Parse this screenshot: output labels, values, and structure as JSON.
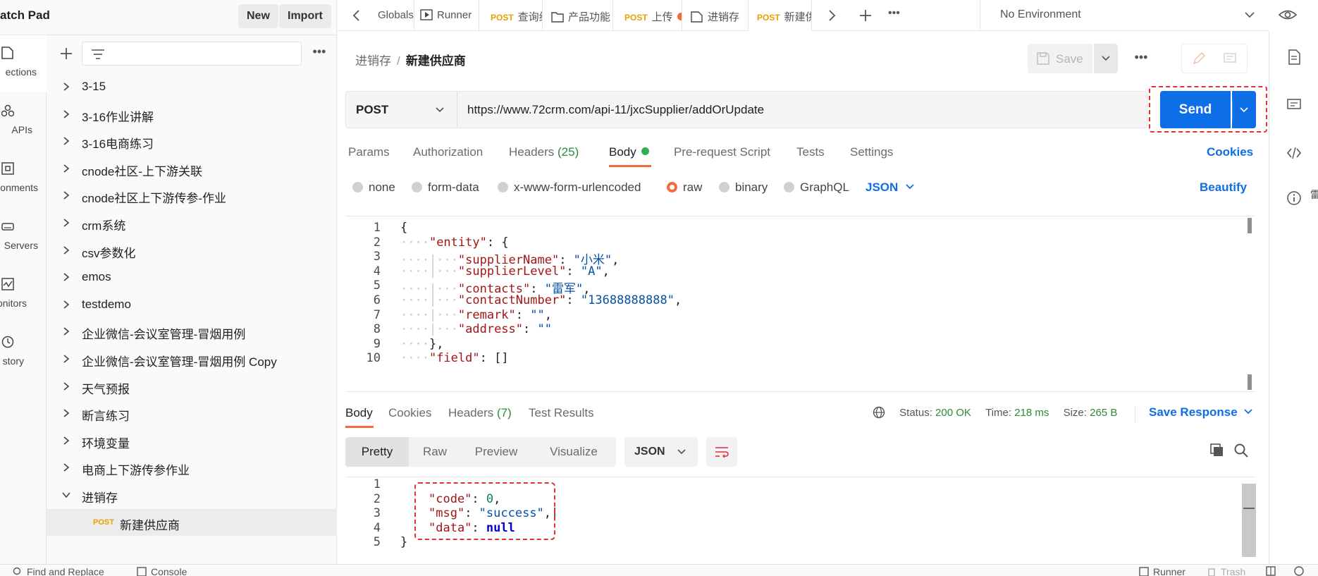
{
  "workspace": {
    "title": "atch Pad",
    "new_label": "New",
    "import_label": "Import"
  },
  "rail": [
    {
      "label": "ections",
      "icon": "collections-icon"
    },
    {
      "label": "APIs",
      "icon": "apis-icon"
    },
    {
      "label": "onments",
      "icon": "environments-icon"
    },
    {
      "label": "Servers",
      "icon": "mock-servers-icon"
    },
    {
      "label": "onitors",
      "icon": "monitors-icon"
    },
    {
      "label": "story",
      "icon": "history-icon"
    }
  ],
  "sidebar": {
    "collections": [
      "3-15",
      "3-16作业讲解",
      "3-16电商练习",
      "cnode社区-上下游关联",
      "cnode社区上下游传参-作业",
      "crm系统",
      "csv参数化",
      "emos",
      "testdemo",
      "企业微信-会议室管理-冒烟用例",
      "企业微信-会议室管理-冒烟用例 Copy",
      "天气预报",
      "断言练习",
      "环境变量",
      "电商上下游传参作业",
      "进销存"
    ],
    "child": {
      "method": "POST",
      "name": "新建供应商"
    }
  },
  "tabs": [
    {
      "method": "",
      "title": "Globals",
      "icon": "globe-icon"
    },
    {
      "method": "",
      "title": "Runner",
      "icon": "runner-icon"
    },
    {
      "method": "POST",
      "title": "查询组",
      "icon": ""
    },
    {
      "method": "",
      "title": "产品功能",
      "icon": "folder-icon"
    },
    {
      "method": "POST",
      "title": "上传",
      "icon": ""
    },
    {
      "method": "",
      "title": "进销存",
      "icon": "collection-icon"
    },
    {
      "method": "POST",
      "title": "新建供",
      "icon": ""
    }
  ],
  "environment": {
    "label": "No Environment"
  },
  "request": {
    "breadcrumb_parent": "进销存",
    "breadcrumb_separator": "/",
    "breadcrumb_current": "新建供应商",
    "save_label": "Save",
    "method": "POST",
    "url": "https://www.72crm.com/api-11/jxcSupplier/addOrUpdate",
    "send_label": "Send",
    "tabs": {
      "params": "Params",
      "authorization": "Authorization",
      "headers": "Headers",
      "headers_count": "(25)",
      "body": "Body",
      "prerequest": "Pre-request Script",
      "tests": "Tests",
      "settings": "Settings"
    },
    "cookies_label": "Cookies",
    "body_types": {
      "none": "none",
      "form_data": "form-data",
      "urlencoded": "x-www-form-urlencoded",
      "raw": "raw",
      "binary": "binary",
      "graphql": "GraphQL"
    },
    "selected_body_type": "raw",
    "raw_language": "JSON",
    "beautify_label": "Beautify",
    "line_numbers": [
      "1",
      "2",
      "3",
      "4",
      "5",
      "6",
      "7",
      "8",
      "9",
      "10"
    ],
    "code": {
      "l1": "{",
      "entity_key": "\"entity\"",
      "l2_tail": ": {",
      "supplierName_key": "\"supplierName\"",
      "supplierName_val": "\"小米\"",
      "supplierLevel_key": "\"supplierLevel\"",
      "supplierLevel_val": "\"A\"",
      "contacts_key": "\"contacts\"",
      "contacts_val": "\"雷军\"",
      "contactNumber_key": "\"contactNumber\"",
      "contactNumber_val": "\"13688888888\"",
      "remark_key": "\"remark\"",
      "remark_val": "\"\"",
      "address_key": "\"address\"",
      "address_val": "\"\"",
      "l9": "},",
      "field_key": "\"field\"",
      "field_val": "[]"
    }
  },
  "response": {
    "tabs": {
      "body": "Body",
      "cookies": "Cookies",
      "headers": "Headers",
      "headers_count": "(7)",
      "test_results": "Test Results"
    },
    "status_label": "Status:",
    "status": "200 OK",
    "time_label": "Time:",
    "time": "218 ms",
    "size_label": "Size:",
    "size": "265 B",
    "save_label": "Save Response",
    "view_modes": {
      "pretty": "Pretty",
      "raw": "Raw",
      "preview": "Preview",
      "visualize": "Visualize"
    },
    "language": "JSON",
    "line_numbers": [
      "1",
      "2",
      "3",
      "4",
      "5"
    ],
    "code": {
      "code_key": "\"code\"",
      "code_val": "0",
      "msg_key": "\"msg\"",
      "msg_val": "\"success\"",
      "data_key": "\"data\"",
      "data_val": "null",
      "close": "}"
    }
  },
  "right_rail_edge_text": "雷",
  "footer": {
    "find_replace": "Find and Replace",
    "console": "Console",
    "runner": "Runner",
    "trash": "Trash"
  },
  "colors": {
    "accent": "#0d6ee8",
    "method_post": "#e8a100",
    "active_tab": "#f26b3a",
    "status_ok": "#2c8a3a",
    "highlight_frame": "#e0303a"
  }
}
